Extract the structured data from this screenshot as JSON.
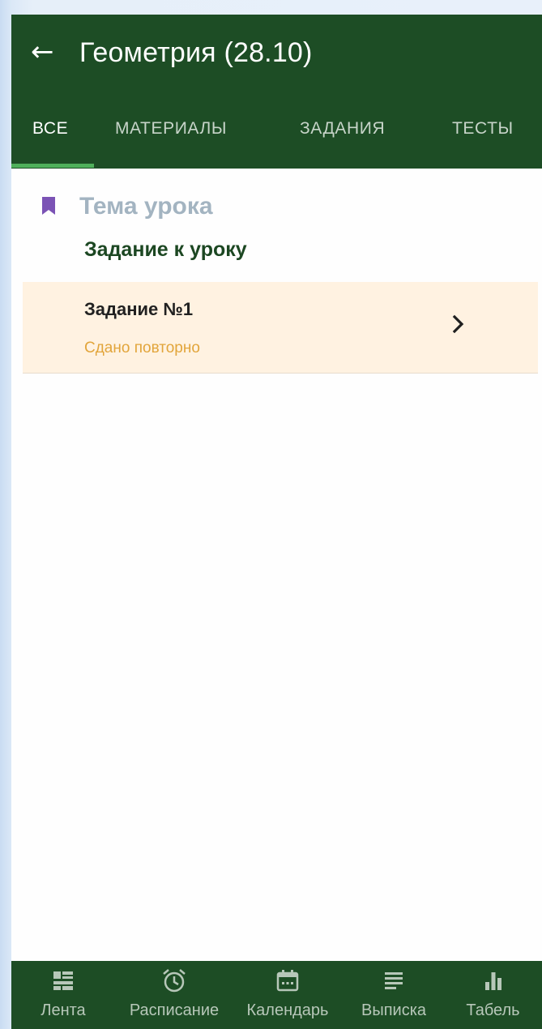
{
  "header": {
    "back_icon": "arrow-left-icon",
    "back_glyph": "←",
    "title": "Геометрия (28.10)"
  },
  "tabs": [
    {
      "label": "ВСЕ",
      "active": true
    },
    {
      "label": "МАТЕРИАЛЫ",
      "active": false
    },
    {
      "label": "ЗАДАНИЯ",
      "active": false
    },
    {
      "label": "ТЕСТЫ",
      "active": false
    }
  ],
  "content": {
    "topic_icon": "bookmark-icon",
    "topic_label": "Тема урока",
    "section_title": "Задание к уроку",
    "task": {
      "name": "Задание №1",
      "status": "Сдано повторно",
      "chevron_icon": "chevron-right-icon"
    }
  },
  "bottom_nav": [
    {
      "label": "Лента",
      "icon": "feed-icon"
    },
    {
      "label": "Расписание",
      "icon": "alarm-clock-icon"
    },
    {
      "label": "Календарь",
      "icon": "calendar-icon"
    },
    {
      "label": "Выписка",
      "icon": "list-icon"
    },
    {
      "label": "Табель",
      "icon": "bar-chart-icon"
    }
  ],
  "colors": {
    "primary": "#1d4d25",
    "tab_indicator": "#4fb05b",
    "bookmark": "#7b53b5",
    "topic_text": "#a3b4c1",
    "section_title": "#1c4722",
    "task_background": "#fff2e1",
    "status_text": "#e2a53b",
    "nav_inactive": "#b7c7b9"
  }
}
